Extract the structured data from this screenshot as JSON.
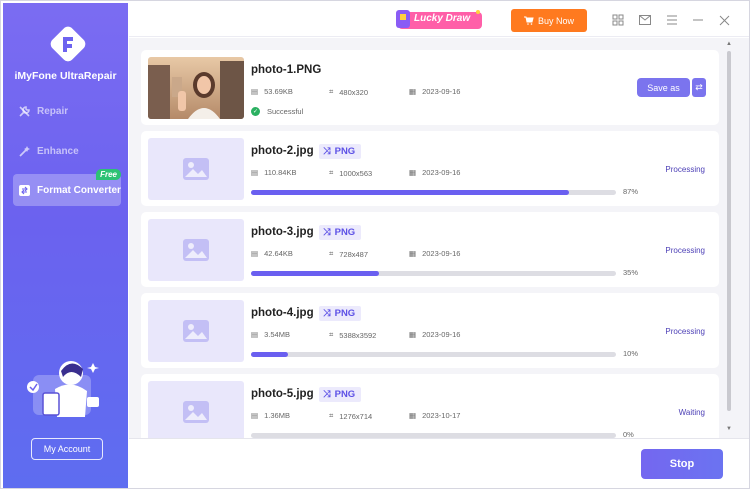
{
  "app": {
    "brand": "iMyFone UltraRepair"
  },
  "sidebar": {
    "items": [
      {
        "label": "Repair",
        "icon": "wrench-icon"
      },
      {
        "label": "Enhance",
        "icon": "wand-icon"
      },
      {
        "label": "Format Converter",
        "icon": "convert-icon",
        "badge": "Free"
      }
    ],
    "account_label": "My Account"
  },
  "topbar": {
    "promo_label": "Lucky Draw",
    "buy_label": "Buy Now"
  },
  "files": [
    {
      "name": "photo-1.PNG",
      "size": "53.69KB",
      "dims": "480x320",
      "date": "2023-09-16",
      "status": "Successful",
      "save_label": "Save as"
    },
    {
      "name": "photo-2.jpg",
      "format": "PNG",
      "size": "110.84KB",
      "dims": "1000x563",
      "date": "2023-09-16",
      "progress": 87,
      "progress_label": "87%",
      "state": "Processing"
    },
    {
      "name": "photo-3.jpg",
      "format": "PNG",
      "size": "42.64KB",
      "dims": "728x487",
      "date": "2023-09-16",
      "progress": 35,
      "progress_label": "35%",
      "state": "Processing"
    },
    {
      "name": "photo-4.jpg",
      "format": "PNG",
      "size": "3.54MB",
      "dims": "5388x3592",
      "date": "2023-09-16",
      "progress": 10,
      "progress_label": "10%",
      "state": "Processing"
    },
    {
      "name": "photo-5.jpg",
      "format": "PNG",
      "size": "1.36MB",
      "dims": "1276x714",
      "date": "2023-10-17",
      "progress": 0,
      "progress_label": "0%",
      "state": "Waiting"
    }
  ],
  "footer": {
    "stop_label": "Stop"
  },
  "colors": {
    "accent": "#6a5ff0",
    "buy": "#ff7a1f",
    "success": "#2bb061"
  }
}
